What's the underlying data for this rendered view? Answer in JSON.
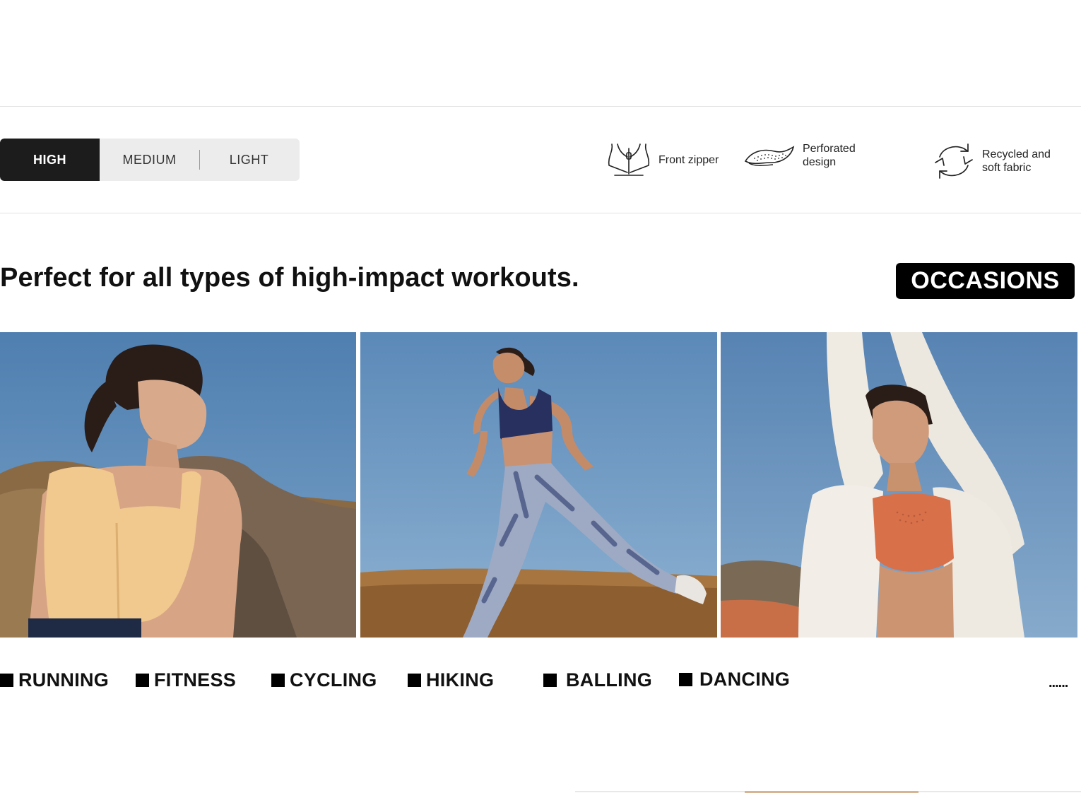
{
  "support_levels": {
    "options": [
      "HIGH",
      "MEDIUM",
      "LIGHT"
    ],
    "selected": "HIGH"
  },
  "features": [
    {
      "icon": "zipper-icon",
      "label": "Front zipper"
    },
    {
      "icon": "perforated-fabric-icon",
      "label": "Perforated\ndesign"
    },
    {
      "icon": "recycle-icon",
      "label": "Recycled and\nsoft fabric"
    }
  ],
  "headline": "Perfect for all types of high-impact workouts.",
  "badge": "OCCASIONS",
  "photos": [
    {
      "name": "photo-woman-resting-beige-bra"
    },
    {
      "name": "photo-woman-running-navy-bra"
    },
    {
      "name": "photo-woman-stretching-orange-bra"
    }
  ],
  "occasions": [
    "RUNNING",
    "FITNESS",
    "CYCLING",
    "HIKING",
    "BALLING",
    "DANCING"
  ],
  "more_label": "......",
  "colors": {
    "accent": "#1c1c1c",
    "segment_bg": "#ececec",
    "sky": "#5a86b4"
  }
}
